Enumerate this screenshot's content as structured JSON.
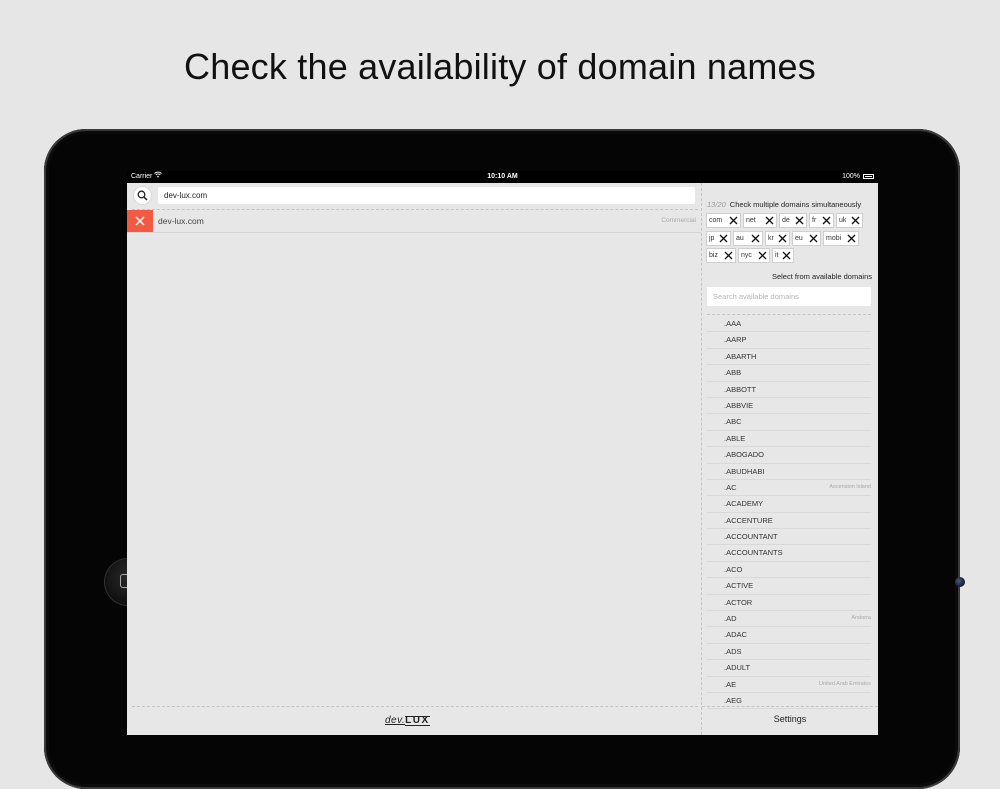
{
  "headline": "Check the availability of domain names",
  "status_bar": {
    "carrier": "Carrier",
    "time": "10:10 AM",
    "battery": "100%"
  },
  "search": {
    "value": "dev-lux.com"
  },
  "results": [
    {
      "domain": "dev-lux.com",
      "category": "Commercial",
      "status": "unavailable"
    }
  ],
  "logo": {
    "part1": "dev.",
    "part2": "LUX"
  },
  "multi": {
    "count": "13/20",
    "label": "Check multiple domains simultaneously"
  },
  "selected_tlds": [
    "com",
    "net",
    "de",
    "fr",
    "uk",
    "jp",
    "au",
    "kr",
    "eu",
    "mobi",
    "biz",
    "nyc",
    "it"
  ],
  "select_label": "Select from available domains",
  "avail_search": {
    "placeholder": "Search available domains"
  },
  "available_domains": [
    {
      "tld": ".AAA",
      "country": ""
    },
    {
      "tld": ".AARP",
      "country": ""
    },
    {
      "tld": ".ABARTH",
      "country": ""
    },
    {
      "tld": ".ABB",
      "country": ""
    },
    {
      "tld": ".ABBOTT",
      "country": ""
    },
    {
      "tld": ".ABBVIE",
      "country": ""
    },
    {
      "tld": ".ABC",
      "country": ""
    },
    {
      "tld": ".ABLE",
      "country": ""
    },
    {
      "tld": ".ABOGADO",
      "country": ""
    },
    {
      "tld": ".ABUDHABI",
      "country": ""
    },
    {
      "tld": ".AC",
      "country": "Ascension Island"
    },
    {
      "tld": ".ACADEMY",
      "country": ""
    },
    {
      "tld": ".ACCENTURE",
      "country": ""
    },
    {
      "tld": ".ACCOUNTANT",
      "country": ""
    },
    {
      "tld": ".ACCOUNTANTS",
      "country": ""
    },
    {
      "tld": ".ACO",
      "country": ""
    },
    {
      "tld": ".ACTIVE",
      "country": ""
    },
    {
      "tld": ".ACTOR",
      "country": ""
    },
    {
      "tld": ".AD",
      "country": "Andorra"
    },
    {
      "tld": ".ADAC",
      "country": ""
    },
    {
      "tld": ".ADS",
      "country": ""
    },
    {
      "tld": ".ADULT",
      "country": ""
    },
    {
      "tld": ".AE",
      "country": "United Arab Emirates"
    },
    {
      "tld": ".AEG",
      "country": ""
    }
  ],
  "settings_label": "Settings",
  "colors": {
    "remove_red": "#f25a44",
    "background": "#e7e7e7",
    "device": "#050505"
  }
}
